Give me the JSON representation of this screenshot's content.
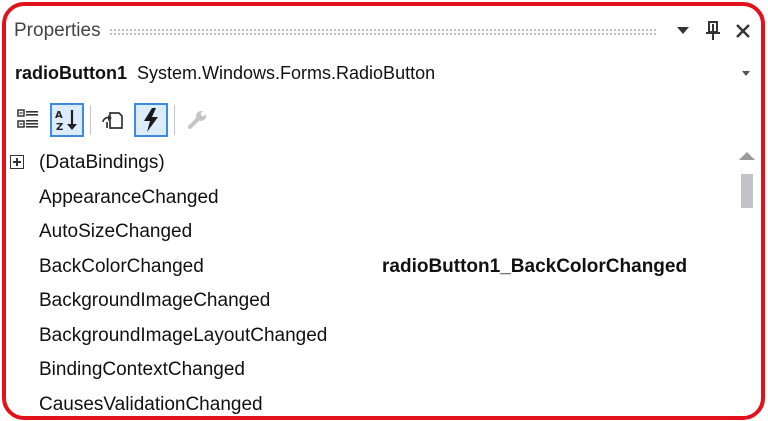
{
  "window": {
    "title": "Properties"
  },
  "object_selector": {
    "name": "radioButton1",
    "type": "System.Windows.Forms.RadioButton"
  },
  "toolbar": {
    "buttons": [
      {
        "icon": "categorized-icon",
        "active": false
      },
      {
        "icon": "alphabetical-icon",
        "active": true
      },
      {
        "icon": "properties-icon",
        "active": false
      },
      {
        "icon": "events-lightning-icon",
        "active": true
      },
      {
        "icon": "property-pages-wrench-icon",
        "active": false,
        "disabled": true
      }
    ]
  },
  "grid": {
    "rows": [
      {
        "name": "(DataBindings)",
        "value": "",
        "expandable": true
      },
      {
        "name": "AppearanceChanged",
        "value": ""
      },
      {
        "name": "AutoSizeChanged",
        "value": ""
      },
      {
        "name": "BackColorChanged",
        "value": "radioButton1_BackColorChanged"
      },
      {
        "name": "BackgroundImageChanged",
        "value": ""
      },
      {
        "name": "BackgroundImageLayoutChanged",
        "value": ""
      },
      {
        "name": "BindingContextChanged",
        "value": ""
      },
      {
        "name": "CausesValidationChanged",
        "value": ""
      }
    ]
  },
  "colors": {
    "highlight_border": "#e2121c",
    "active_button_border": "#3b8be0"
  }
}
